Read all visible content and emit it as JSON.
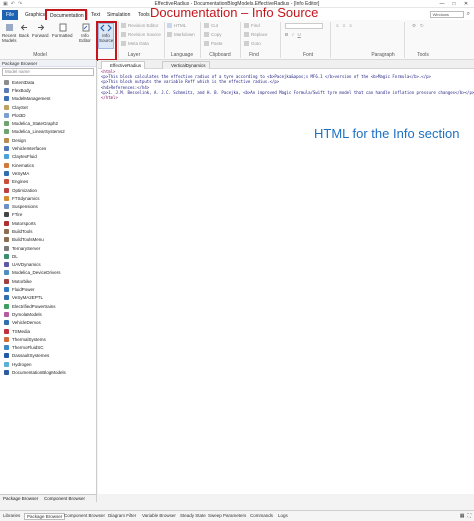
{
  "window": {
    "title": "EffectiveRadius - DocumentationBlogModels.EffectiveRadius - [Info Editor]",
    "minimize": "—",
    "maximize": "□",
    "close": "✕"
  },
  "annotations": {
    "top": "Documentation – Info Source",
    "middle": "HTML for the Info section"
  },
  "menu_tabs": [
    "File",
    "Graphics",
    "Documentation",
    "Text",
    "Simulation",
    "Tools"
  ],
  "active_tab": "Documentation",
  "right_controls": {
    "style_select": "Windows",
    "search_icon": "search-icon"
  },
  "ribbon": {
    "model_buttons": [
      "Recent Models",
      "Back",
      "Forward",
      "Formatted",
      "Info Editor",
      "Info Source"
    ],
    "info_label": "Info",
    "source_label": "Source",
    "layer_items": [
      "Revision Editor",
      "Revision Source",
      "Meta Data"
    ],
    "language_items": [
      "HTML",
      "Markdown"
    ],
    "clipboard_items": [
      "Cut",
      "Copy",
      "Paste"
    ],
    "find_items": [
      "Find",
      "Replace",
      "Goto"
    ],
    "font_items": [
      "B",
      "I",
      "U"
    ],
    "paragraph_items": [
      "≡",
      "≡",
      "≡"
    ],
    "tools_items": [
      "⚙",
      "↻"
    ],
    "group_labels": [
      "Model",
      "Layer",
      "Language",
      "Clipboard",
      "Find",
      "Font",
      "Paragraph",
      "Tools"
    ]
  },
  "package_browser": {
    "title": "Package Browser",
    "search_placeholder": "Model name",
    "items": [
      "ExtentData",
      "FlexBody",
      "ModelManagement",
      "ClaySet",
      "Plot3D",
      "Modelica_StateGraph2",
      "Modelica_LinearSystems2",
      "Design",
      "VehicleInterfaces",
      "ClaytexFluid",
      "Kinematics",
      "VeSyMA",
      "Engines",
      "Optimization",
      "FTSdynamics",
      "Suspensions",
      "FTire",
      "Motorsports",
      "BuildTools",
      "BuildToolsMenu",
      "TernaryServer",
      "DL",
      "UAVDynamics",
      "Modelica_DeviceDrivers",
      "Motorbike",
      "FluidPower",
      "VeSyMA2EPTL",
      "ElectrifiedPowertrains",
      "DymolaModels",
      "VehicleDemos",
      "TSMedia",
      "ThermalSystems",
      "ThermoFluidSC",
      "DassaultSystemes",
      "Hydrogen",
      "DocumentationBlogModels"
    ],
    "icon_colors": [
      "#8c8c8c",
      "#5a7bb5",
      "#3b6fb6",
      "#c0a060",
      "#7a9fd0",
      "#6fa36f",
      "#6fa36f",
      "#b98b4f",
      "#4e79b6",
      "#4aa0d8",
      "#d07a3a",
      "#2f6fb0",
      "#c94f3a",
      "#c04040",
      "#d58a2d",
      "#6b8fc7",
      "#444444",
      "#b03030",
      "#8d6e4f",
      "#8d6e4f",
      "#7a7a7a",
      "#3a8e6e",
      "#5a5aa8",
      "#4f8fbf",
      "#a04040",
      "#2f7ac0",
      "#2f6fb0",
      "#3a9e5e",
      "#b45a9e",
      "#2f6fb0",
      "#c0303a",
      "#d06a3a",
      "#3a88c4",
      "#1e5aa8",
      "#5ab0d8",
      "#2d5b9e"
    ],
    "bottom_tabs": [
      "Package Browser",
      "Component Browser"
    ]
  },
  "document_tabs": [
    "EffectiveRadius",
    "VerticalDynamics"
  ],
  "editor_lines": [
    "<html>",
    "<p>This block calculates the effective radius of a tyre according to <b>Pacejka&apos;s MF6.1 </b>version of the <b>Magic Formula</b>.</p>",
    "<p>This block outputs the variable Reff which is the effective radius.</p>",
    "<h4>References:</h4>",
    "<p>1. J.M. Besselink, A. J.C. Schmeitz, and H. B. Pacejka, <b>An improved Magic Formula/Swift tyre model that can handle inflation pressure changes</b></p>",
    "</html>"
  ],
  "bottom_browser_tabs": [
    "Package Browser",
    "Component Browser"
  ],
  "status_tabs": [
    "Libraries",
    "Package Browser",
    "Component Browser",
    "Diagram Filter",
    "Variable Browser",
    "Steady State",
    "Sweep Parameters",
    "Commands",
    "Logs"
  ],
  "status_selected": "Package Browser"
}
